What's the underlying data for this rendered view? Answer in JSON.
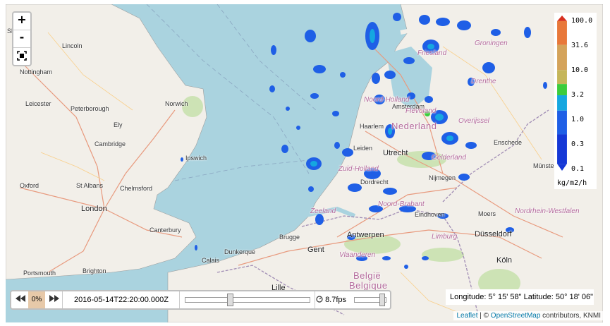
{
  "controls": {
    "zoom_in": "+",
    "zoom_out": "-",
    "fullscreen_icon": "fullscreen-icon"
  },
  "legend": {
    "ticks": [
      "100.0",
      "31.6",
      "10.0",
      "3.2",
      "1.0",
      "0.3",
      "0.1"
    ],
    "unit": "kg/m2/h",
    "colors": [
      "#d7301f",
      "#e8783a",
      "#d4a35a",
      "#c5b65a",
      "#3ccc3c",
      "#15a7e0",
      "#1f5fe6",
      "#1538d6"
    ]
  },
  "time": {
    "percent": "0%",
    "timestamp": "2016-05-14T22:20:00.000Z",
    "fps": "8.7fps",
    "time_slider_fraction": 0.35,
    "speed_slider_fraction": 0.9
  },
  "coordinates": "Longitude: 5° 15' 58\" Latitude: 50° 18' 06\"",
  "attribution": {
    "leaflet": "Leaflet",
    "sep": " | © ",
    "osm": "OpenStreetMap",
    "rest": " contributors, KNMI"
  },
  "map_labels": {
    "places": [
      "Sheffield",
      "Lincoln",
      "Nottingham",
      "Leicester",
      "Peterborough",
      "Norwich",
      "Ely",
      "Cambridge",
      "Oxford",
      "St Albans",
      "Chelmsford",
      "Ipswich",
      "London",
      "Canterbury",
      "Portsmouth",
      "Brighton",
      "Calais",
      "Dunkerque",
      "Brugge",
      "Gent",
      "Antwerpen",
      "Lille",
      "Haarlem",
      "Amsterdam",
      "Leiden",
      "Utrecht",
      "Dordrecht",
      "Nijmegen",
      "Eindhoven",
      "Enschede",
      "Münster",
      "Groningen",
      "Drenthe",
      "Moers",
      "Düsseldorf",
      "Köln"
    ],
    "provinces": [
      "Friesland",
      "Noord-Holland",
      "Flevoland",
      "Overijssel",
      "Gelderland",
      "Zuid-Holland",
      "Zeeland",
      "Noord-Brabant",
      "Limburg",
      "Vlaanderen",
      "Nordrhein-Westfalen",
      "België",
      "Belgique"
    ],
    "countries": [
      "Nederland",
      "België",
      "Belgique"
    ]
  }
}
